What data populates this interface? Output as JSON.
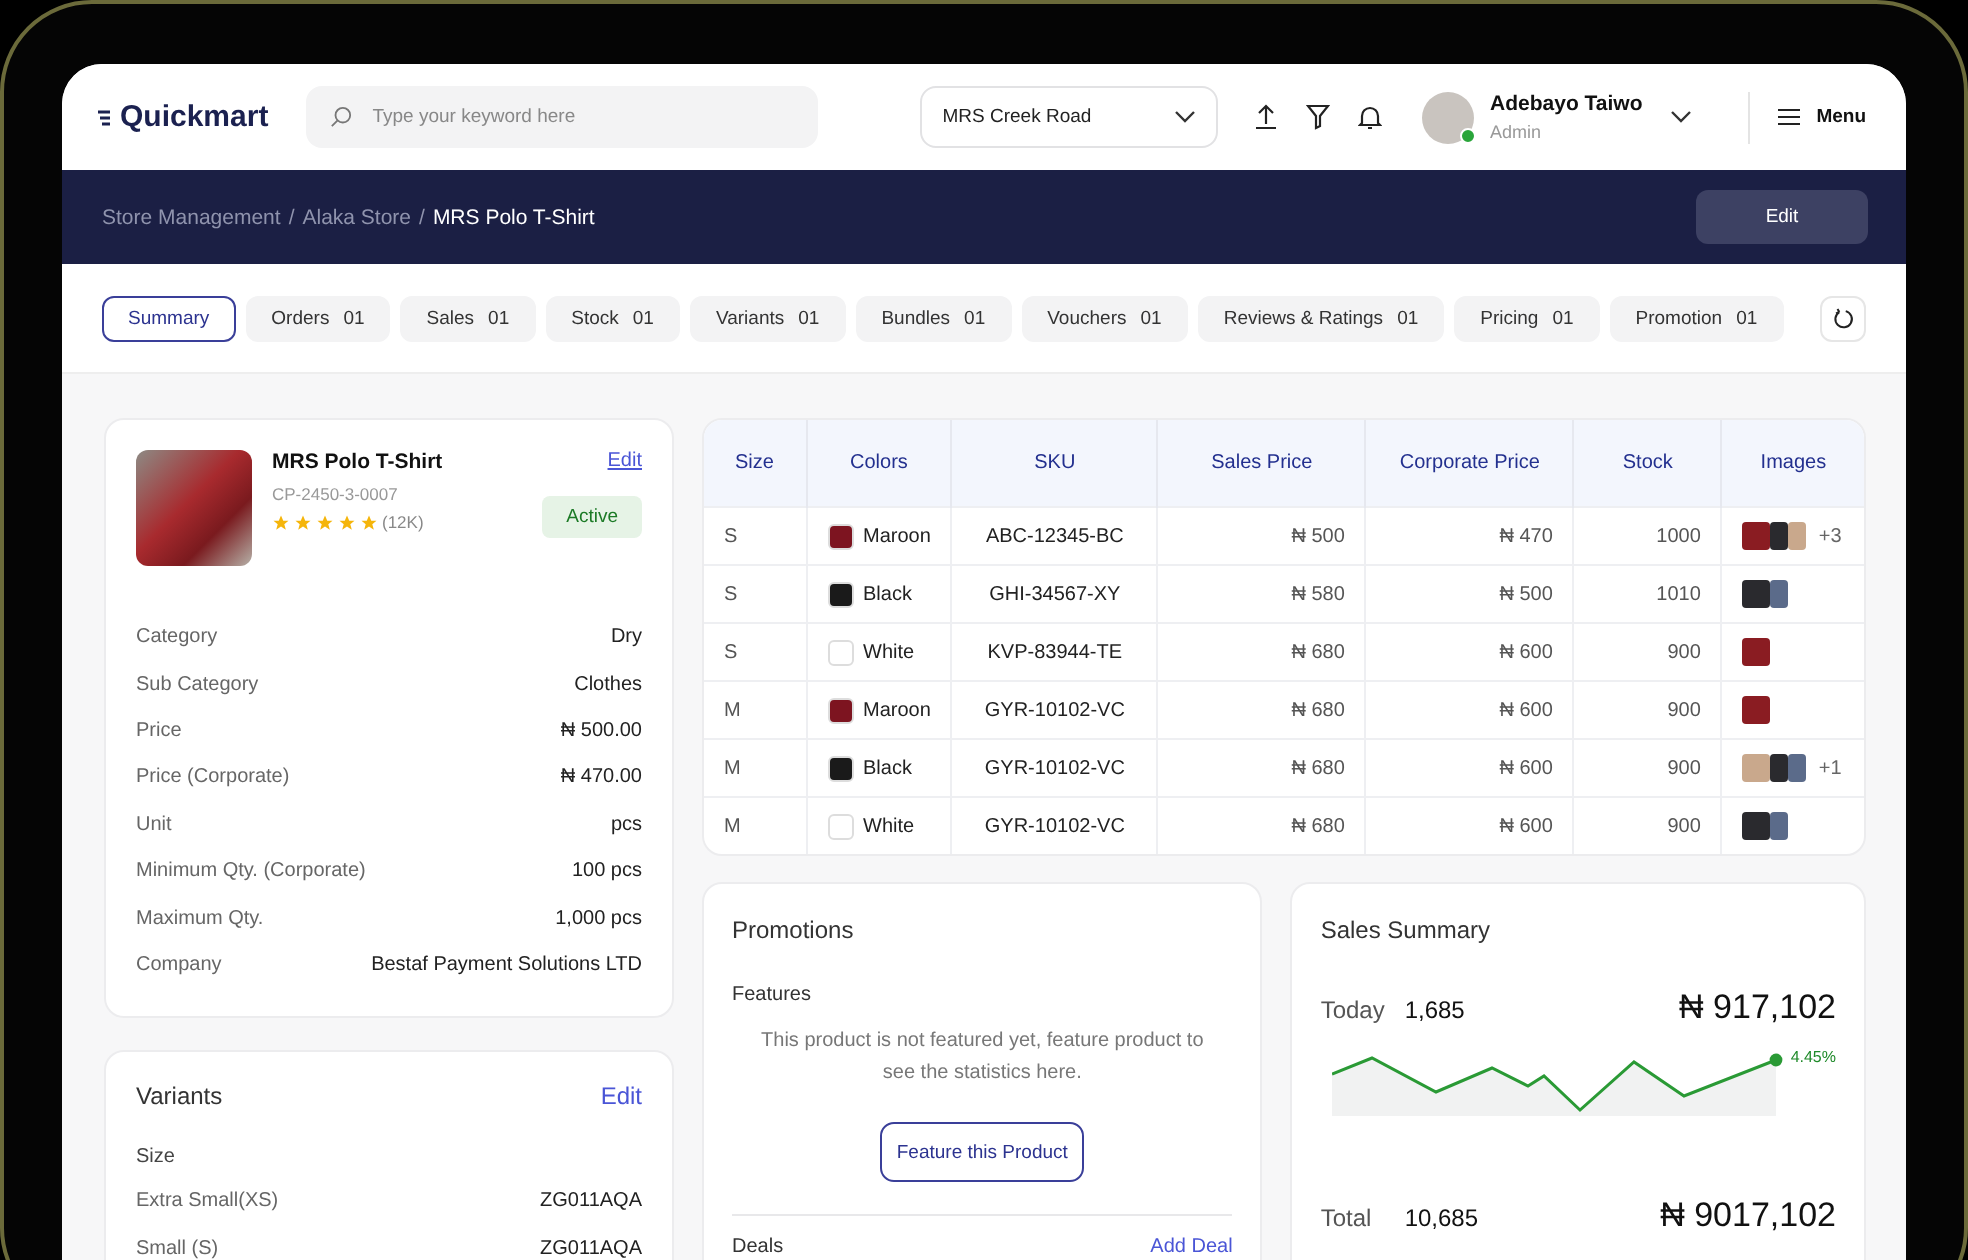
{
  "header": {
    "logo": "Quickmart",
    "search": {
      "placeholder": "Type your keyword here"
    },
    "store": "MRS Creek Road",
    "user": {
      "name": "Adebayo Taiwo",
      "role": "Admin",
      "online": true
    },
    "menu": "Menu"
  },
  "breadcrumb": [
    {
      "label": "Store Management",
      "separator": "/",
      "current": false
    },
    {
      "label": "Alaka Store",
      "separator": "/",
      "current": false
    },
    {
      "label": "MRS Polo T-Shirt",
      "current": true
    }
  ],
  "edit_button": "Edit",
  "tabs": [
    {
      "label": "Summary",
      "selected": true
    },
    {
      "label": "Orders",
      "count": "01",
      "selected": false
    },
    {
      "label": "Sales",
      "count": "01",
      "selected": false
    },
    {
      "label": "Stock",
      "count": "01",
      "selected": false
    },
    {
      "label": "Variants",
      "count": "01",
      "selected": false
    },
    {
      "label": "Bundles",
      "count": "01",
      "selected": false
    },
    {
      "label": "Vouchers",
      "count": "01",
      "selected": false
    },
    {
      "label": "Reviews & Ratings",
      "count": "01",
      "selected": false
    },
    {
      "label": "Pricing",
      "count": "01",
      "selected": false
    },
    {
      "label": "Promotion",
      "count": "01",
      "selected": false
    }
  ],
  "product": {
    "name": "MRS Polo T-Shirt",
    "code": "CP-2450-3-0007",
    "stars": 5,
    "reviews": "(12K)",
    "edit": "Edit",
    "status": "Active",
    "details": [
      {
        "label": "Category",
        "value": "Dry"
      },
      {
        "label": "Sub Category",
        "value": "Clothes"
      },
      {
        "label": "Price",
        "value": "₦ 500.00"
      },
      {
        "label": "Price (Corporate)",
        "value": "₦ 470.00"
      },
      {
        "label": "Unit",
        "value": "pcs"
      },
      {
        "label": "Minimum Qty. (Corporate)",
        "value": "100 pcs"
      },
      {
        "label": "Maximum Qty.",
        "value": "1,000 pcs"
      },
      {
        "label": "Company",
        "value": "Bestaf Payment Solutions LTD"
      }
    ]
  },
  "variants": {
    "title": "Variants",
    "edit": "Edit",
    "group": "Size",
    "items": [
      {
        "label": "Extra Small(XS)",
        "value": "ZG011AQA"
      },
      {
        "label": "Small (S)",
        "value": "ZG011AQA"
      }
    ]
  },
  "table": {
    "columns": [
      "Size",
      "Colors",
      "SKU",
      "Sales Price",
      "Corporate Price",
      "Stock",
      "Images"
    ],
    "rows": [
      {
        "size": "S",
        "color": "#7d1420",
        "color_name": "Maroon",
        "sku": "ABC-12345-BC",
        "sales_price": "₦ 500",
        "corporate_price": "₦ 470",
        "stock": "1000",
        "images": [
          {
            "color": "#8a1c22"
          },
          {
            "color": "#2a2a2e"
          },
          {
            "color": "#c9a88c"
          }
        ],
        "more": "+3"
      },
      {
        "size": "S",
        "color": "#1a1a1a",
        "color_name": "Black",
        "sku": "GHI-34567-XY",
        "sales_price": "₦ 580",
        "corporate_price": "₦ 500",
        "stock": "1010",
        "images": [
          {
            "color": "#2a2a2e"
          },
          {
            "color": "#5b6b8a"
          }
        ]
      },
      {
        "size": "S",
        "color": "#ffffff",
        "color_name": "White",
        "sku": "KVP-83944-TE",
        "sales_price": "₦ 680",
        "corporate_price": "₦ 600",
        "stock": "900",
        "images": [
          {
            "color": "#8a1c22"
          }
        ]
      },
      {
        "size": "M",
        "color": "#7d1420",
        "color_name": "Maroon",
        "sku": "GYR-10102-VC",
        "sales_price": "₦ 680",
        "corporate_price": "₦ 600",
        "stock": "900",
        "images": [
          {
            "color": "#8a1c22"
          }
        ]
      },
      {
        "size": "M",
        "color": "#1a1a1a",
        "color_name": "Black",
        "sku": "GYR-10102-VC",
        "sales_price": "₦ 680",
        "corporate_price": "₦ 600",
        "stock": "900",
        "images": [
          {
            "color": "#c9a88c"
          },
          {
            "color": "#2a2a2e"
          },
          {
            "color": "#5b6b8a"
          }
        ],
        "more": "+1"
      },
      {
        "size": "M",
        "color": "#ffffff",
        "color_name": "White",
        "sku": "GYR-10102-VC",
        "sales_price": "₦ 680",
        "corporate_price": "₦ 600",
        "stock": "900",
        "images": [
          {
            "color": "#2a2a2e"
          },
          {
            "color": "#5b6b8a"
          }
        ]
      }
    ]
  },
  "promotions": {
    "title": "Promotions",
    "features_title": "Features",
    "message": "This product is not featured yet, feature product to see the statistics here.",
    "feature_button": "Feature this Product",
    "deals_title": "Deals",
    "add_deal": "Add Deal"
  },
  "sales_summary": {
    "title": "Sales Summary",
    "today_label": "Today",
    "today_count": "1,685",
    "today_amount": "₦ 917,102",
    "change": "4.45%",
    "total_label": "Total",
    "total_count": "10,685",
    "total_amount": "₦ 9017,102"
  }
}
